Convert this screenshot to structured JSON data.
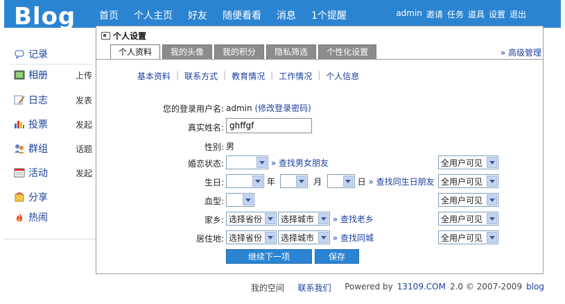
{
  "header": {
    "logo": "Blog",
    "nav": [
      "首页",
      "个人主页",
      "好友",
      "随便看看",
      "消息",
      "1个提醒"
    ],
    "user": [
      "admin",
      "邀请",
      "任务",
      "道具",
      "设置",
      "退出"
    ]
  },
  "sidebar": {
    "items": [
      {
        "label": "记录",
        "sub": "",
        "icon": "speech-bubble-icon"
      },
      {
        "label": "相册",
        "sub": "上传",
        "icon": "photo-icon"
      },
      {
        "label": "日志",
        "sub": "发表",
        "icon": "pencil-note-icon"
      },
      {
        "label": "投票",
        "sub": "发起",
        "icon": "bar-chart-icon"
      },
      {
        "label": "群组",
        "sub": "话题",
        "icon": "group-icon"
      },
      {
        "label": "活动",
        "sub": "发起",
        "icon": "calendar-icon"
      },
      {
        "label": "分享",
        "sub": "",
        "icon": "share-icon"
      },
      {
        "label": "热闹",
        "sub": "",
        "icon": "fire-icon"
      }
    ]
  },
  "dialog": {
    "title": "个人设置",
    "tabs": [
      "个人资料",
      "我的头像",
      "我的积分",
      "隐私筛选",
      "个性化设置"
    ],
    "advanced": "» 高级管理",
    "subnav": [
      "基本资料",
      "联系方式",
      "教育情况",
      "工作情况",
      "个人信息"
    ],
    "form": {
      "username_label": "您的登录用户名:",
      "username": "admin",
      "change_pw": "(修改登录密码)",
      "realname_label": "真实姓名:",
      "realname": "ghffgf",
      "gender_label": "性别:",
      "gender": "男",
      "marital_label": "婚恋状态:",
      "marital_link": "» 查找男女朋友",
      "birthday_label": "生日:",
      "year": "年",
      "month": "月",
      "day": "日",
      "birthday_link": "» 查找同生日朋友",
      "blood_label": "血型:",
      "hometown_label": "家乡:",
      "province": "选择省份",
      "city": "选择城市",
      "hometown_link": "» 查找老乡",
      "residence_label": "居住地:",
      "residence_link": "» 查找同城",
      "privacy": "全用户可见"
    },
    "buttons": {
      "next": "继续下一项",
      "save": "保存"
    }
  },
  "footer": {
    "my_space": "我的空间",
    "contact": "联系我们",
    "powered": "Powered by",
    "site": "13109.COM",
    "version": "2.0 © 2007-2009",
    "blog": "blog"
  },
  "colors": {
    "brand_blue": "#2b84d2",
    "link_blue": "#1a3f9e",
    "tab_gray": "#8c8c8c"
  }
}
